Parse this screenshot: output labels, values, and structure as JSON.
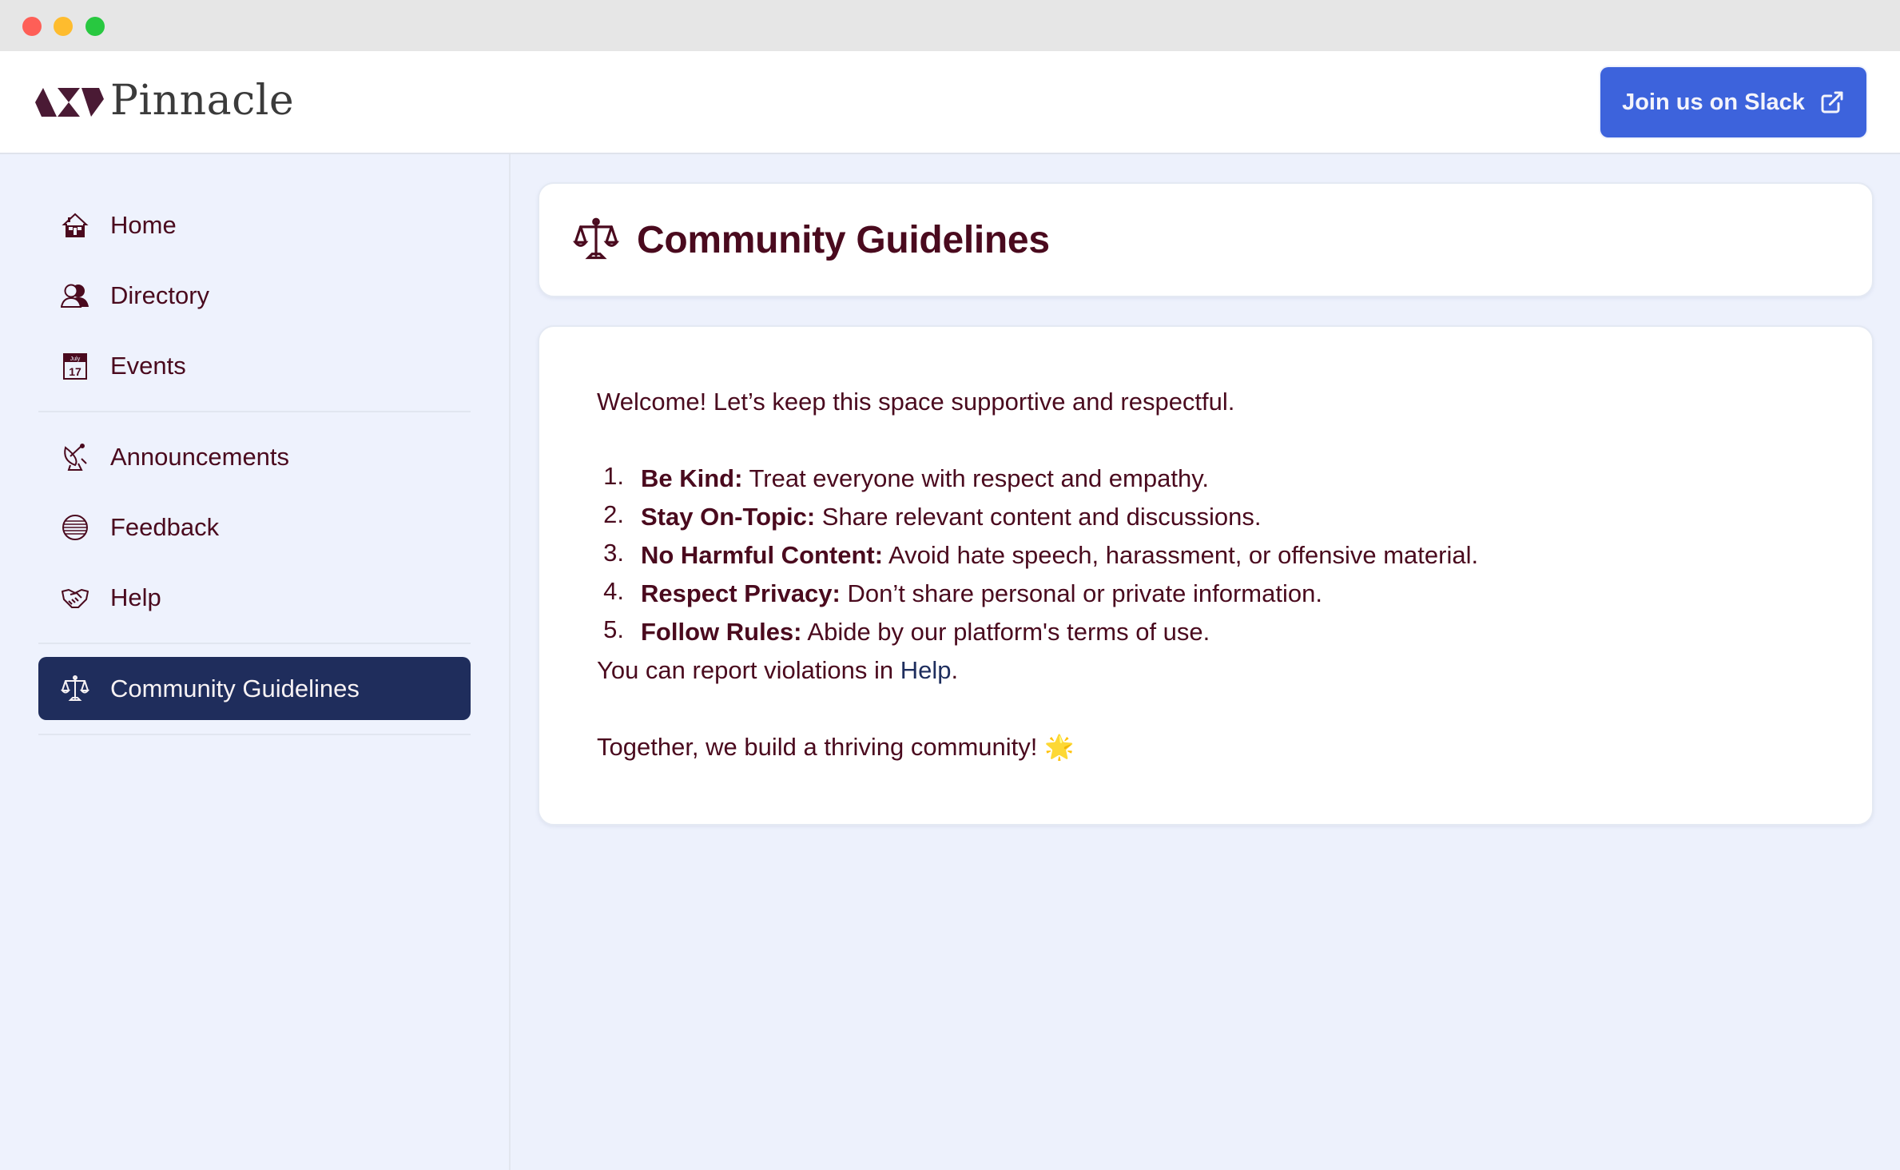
{
  "window": {
    "controls": [
      "close",
      "minimize",
      "maximize"
    ]
  },
  "header": {
    "brand": "Pinnacle",
    "slack_button": {
      "label": "Join us on Slack",
      "icon": "external-link-icon"
    }
  },
  "sidebar": {
    "groups": [
      [
        {
          "label": "Home",
          "icon": "house-icon"
        },
        {
          "label": "Directory",
          "icon": "people-icon"
        },
        {
          "label": "Events",
          "icon": "calendar-icon",
          "calendar_month": "July",
          "calendar_day": "17"
        }
      ],
      [
        {
          "label": "Announcements",
          "icon": "satellite-dish-icon"
        },
        {
          "label": "Feedback",
          "icon": "speech-bubble-icon"
        },
        {
          "label": "Help",
          "icon": "handshake-icon"
        }
      ],
      [
        {
          "label": "Community Guidelines",
          "icon": "scales-icon",
          "active": true
        }
      ]
    ]
  },
  "page": {
    "title": "Community Guidelines",
    "title_icon": "scales-icon",
    "intro": "Welcome! Let’s keep this space supportive and respectful.",
    "rules": [
      {
        "num": "1.",
        "title": "Be Kind:",
        "text": " Treat everyone with respect and empathy."
      },
      {
        "num": "2.",
        "title": "Stay On-Topic:",
        "text": " Share relevant content and discussions."
      },
      {
        "num": "3.",
        "title": "No Harmful Content:",
        "text": " Avoid hate speech, harassment, or offensive material."
      },
      {
        "num": "4.",
        "title": "Respect Privacy:",
        "text": " Don’t share personal or private information."
      },
      {
        "num": "5.",
        "title": "Follow Rules:",
        "text": " Abide by our platform's terms of use."
      }
    ],
    "report_prefix": "You can report violations in ",
    "report_link": "Help",
    "report_suffix": ".",
    "closing": "Together, we build a thriving community! ",
    "closing_emoji": "🌟"
  },
  "colors": {
    "accent": "#3d63dc",
    "active_nav": "#1f2d5c",
    "text": "#4a0a1e",
    "link": "#1e2e5e",
    "sidebar_bg": "#eef2fd"
  }
}
